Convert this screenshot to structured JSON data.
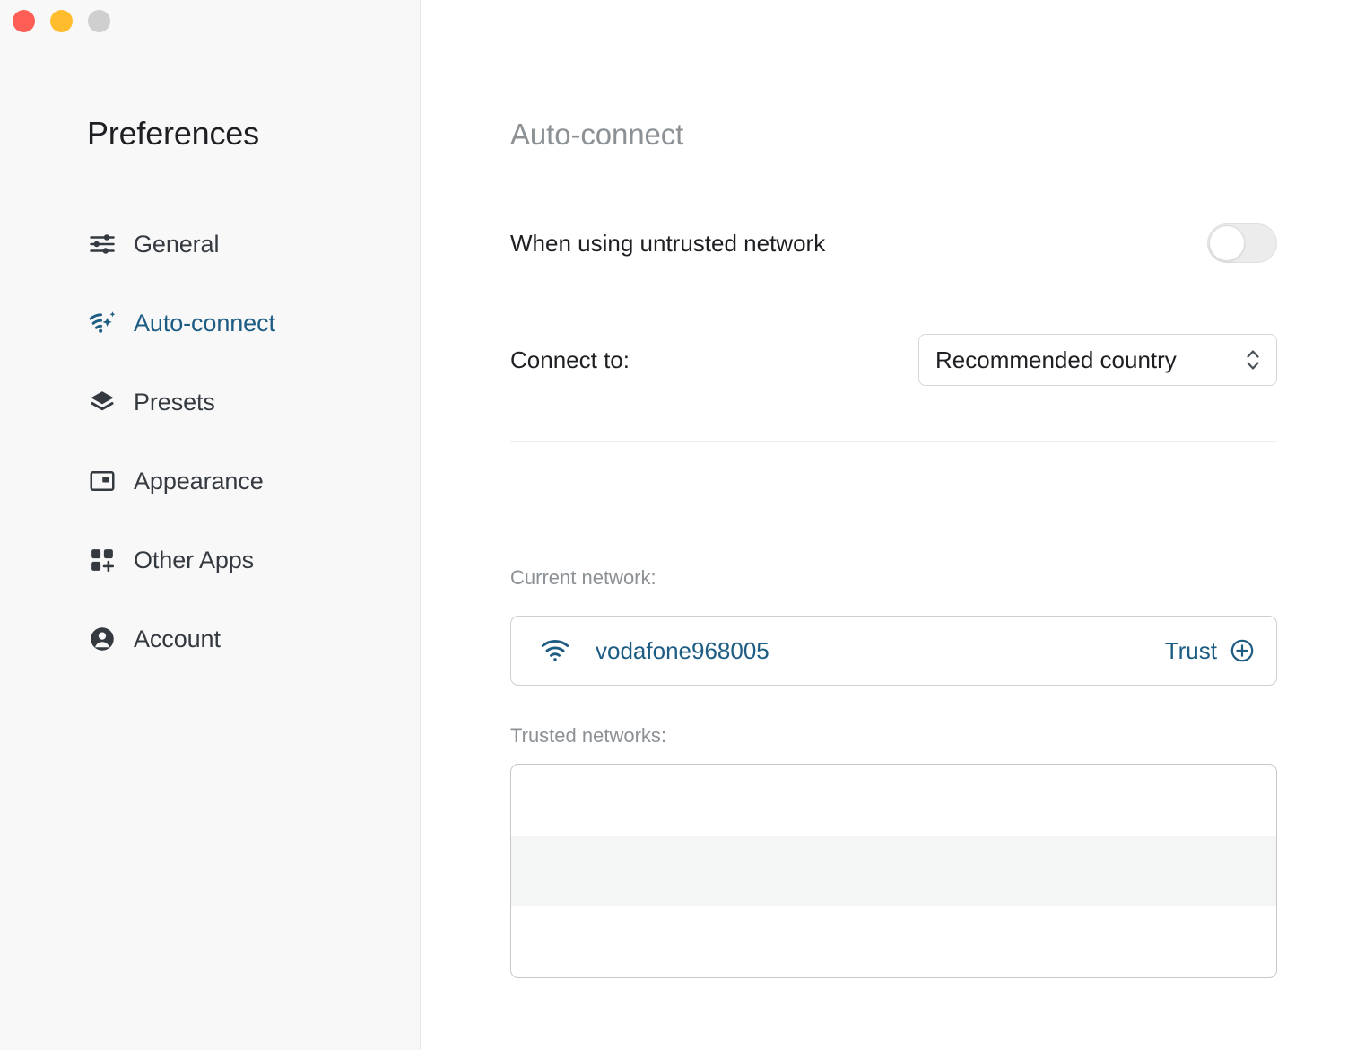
{
  "window": {
    "controls": [
      {
        "name": "close",
        "color": "#ff5e56"
      },
      {
        "name": "minimize",
        "color": "#ffbd2e"
      },
      {
        "name": "zoom",
        "color": "#cfcfcf"
      }
    ]
  },
  "sidebar": {
    "title": "Preferences",
    "items": [
      {
        "label": "General",
        "icon": "sliders-icon",
        "active": false
      },
      {
        "label": "Auto-connect",
        "icon": "wifi-sparkle-icon",
        "active": true
      },
      {
        "label": "Presets",
        "icon": "layers-icon",
        "active": false
      },
      {
        "label": "Appearance",
        "icon": "window-panel-icon",
        "active": false
      },
      {
        "label": "Other Apps",
        "icon": "grid-plus-icon",
        "active": false
      },
      {
        "label": "Account",
        "icon": "person-circle-icon",
        "active": false
      }
    ]
  },
  "main": {
    "title": "Auto-connect",
    "untrusted_network": {
      "label": "When using untrusted network",
      "toggle_state": "off"
    },
    "connect_to": {
      "label": "Connect to:",
      "selected": "Recommended country",
      "options": [
        "Recommended country"
      ]
    },
    "current_network": {
      "label": "Current network:",
      "ssid": "vodafone968005",
      "action_label": "Trust"
    },
    "trusted_networks": {
      "label": "Trusted networks:",
      "items": []
    }
  },
  "colors": {
    "accent": "#1d5c83",
    "muted_text": "#8c9195",
    "body_text": "#1d1f22",
    "sidebar_bg": "#f8f8f9",
    "row_alt_bg": "#f4f6f6"
  }
}
